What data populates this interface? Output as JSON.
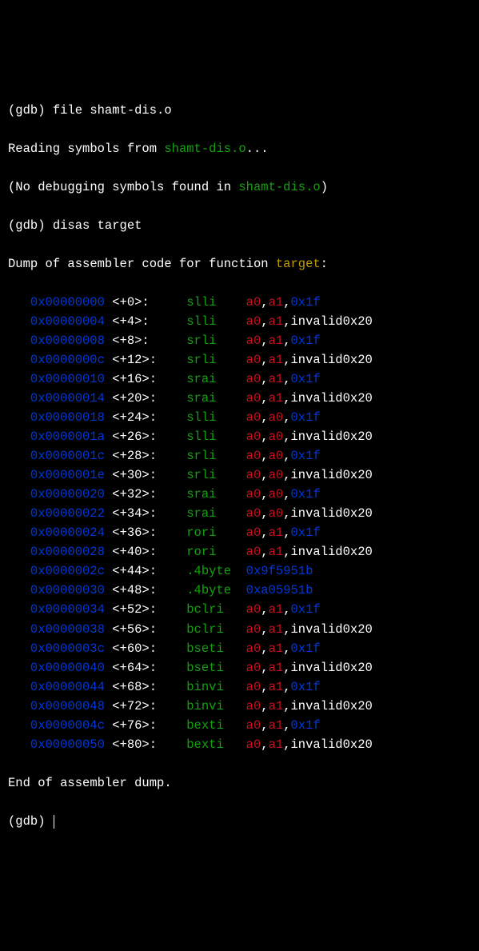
{
  "prompt": "(gdb) ",
  "cmd_file": "file shamt-dis.o",
  "reading_prefix": "Reading symbols from ",
  "filename": "shamt-dis.o",
  "reading_suffix": "...",
  "nodebug_prefix": "(No debugging symbols found in ",
  "nodebug_suffix": ")",
  "cmd_disas": "disas target",
  "dump_prefix": "Dump of assembler code for function ",
  "func": "target",
  "dump_suffix": ":",
  "end_dump": "End of assembler dump.",
  "rows": [
    {
      "addr": "0x00000000",
      "off": "<+0>:",
      "mn": "slli",
      "a0": "a0",
      "a1": "a1",
      "imm": "0x1f",
      "ic": "blue"
    },
    {
      "addr": "0x00000004",
      "off": "<+4>:",
      "mn": "slli",
      "a0": "a0",
      "a1": "a1",
      "imm": "invalid0x20",
      "ic": "white"
    },
    {
      "addr": "0x00000008",
      "off": "<+8>:",
      "mn": "srli",
      "a0": "a0",
      "a1": "a1",
      "imm": "0x1f",
      "ic": "blue"
    },
    {
      "addr": "0x0000000c",
      "off": "<+12>:",
      "mn": "srli",
      "a0": "a0",
      "a1": "a1",
      "imm": "invalid0x20",
      "ic": "white"
    },
    {
      "addr": "0x00000010",
      "off": "<+16>:",
      "mn": "srai",
      "a0": "a0",
      "a1": "a1",
      "imm": "0x1f",
      "ic": "blue"
    },
    {
      "addr": "0x00000014",
      "off": "<+20>:",
      "mn": "srai",
      "a0": "a0",
      "a1": "a1",
      "imm": "invalid0x20",
      "ic": "white"
    },
    {
      "addr": "0x00000018",
      "off": "<+24>:",
      "mn": "slli",
      "a0": "a0",
      "a1": "a0",
      "imm": "0x1f",
      "ic": "blue"
    },
    {
      "addr": "0x0000001a",
      "off": "<+26>:",
      "mn": "slli",
      "a0": "a0",
      "a1": "a0",
      "imm": "invalid0x20",
      "ic": "white"
    },
    {
      "addr": "0x0000001c",
      "off": "<+28>:",
      "mn": "srli",
      "a0": "a0",
      "a1": "a0",
      "imm": "0x1f",
      "ic": "blue"
    },
    {
      "addr": "0x0000001e",
      "off": "<+30>:",
      "mn": "srli",
      "a0": "a0",
      "a1": "a0",
      "imm": "invalid0x20",
      "ic": "white"
    },
    {
      "addr": "0x00000020",
      "off": "<+32>:",
      "mn": "srai",
      "a0": "a0",
      "a1": "a0",
      "imm": "0x1f",
      "ic": "blue"
    },
    {
      "addr": "0x00000022",
      "off": "<+34>:",
      "mn": "srai",
      "a0": "a0",
      "a1": "a0",
      "imm": "invalid0x20",
      "ic": "white"
    },
    {
      "addr": "0x00000024",
      "off": "<+36>:",
      "mn": "rori",
      "a0": "a0",
      "a1": "a1",
      "imm": "0x1f",
      "ic": "blue"
    },
    {
      "addr": "0x00000028",
      "off": "<+40>:",
      "mn": "rori",
      "a0": "a0",
      "a1": "a1",
      "imm": "invalid0x20",
      "ic": "white"
    },
    {
      "addr": "0x0000002c",
      "off": "<+44>:",
      "mn": ".4byte",
      "raw": "0x9f5951b"
    },
    {
      "addr": "0x00000030",
      "off": "<+48>:",
      "mn": ".4byte",
      "raw": "0xa05951b"
    },
    {
      "addr": "0x00000034",
      "off": "<+52>:",
      "mn": "bclri",
      "a0": "a0",
      "a1": "a1",
      "imm": "0x1f",
      "ic": "blue"
    },
    {
      "addr": "0x00000038",
      "off": "<+56>:",
      "mn": "bclri",
      "a0": "a0",
      "a1": "a1",
      "imm": "invalid0x20",
      "ic": "white"
    },
    {
      "addr": "0x0000003c",
      "off": "<+60>:",
      "mn": "bseti",
      "a0": "a0",
      "a1": "a1",
      "imm": "0x1f",
      "ic": "blue"
    },
    {
      "addr": "0x00000040",
      "off": "<+64>:",
      "mn": "bseti",
      "a0": "a0",
      "a1": "a1",
      "imm": "invalid0x20",
      "ic": "white"
    },
    {
      "addr": "0x00000044",
      "off": "<+68>:",
      "mn": "binvi",
      "a0": "a0",
      "a1": "a1",
      "imm": "0x1f",
      "ic": "blue"
    },
    {
      "addr": "0x00000048",
      "off": "<+72>:",
      "mn": "binvi",
      "a0": "a0",
      "a1": "a1",
      "imm": "invalid0x20",
      "ic": "white"
    },
    {
      "addr": "0x0000004c",
      "off": "<+76>:",
      "mn": "bexti",
      "a0": "a0",
      "a1": "a1",
      "imm": "0x1f",
      "ic": "blue"
    },
    {
      "addr": "0x00000050",
      "off": "<+80>:",
      "mn": "bexti",
      "a0": "a0",
      "a1": "a1",
      "imm": "invalid0x20",
      "ic": "white"
    }
  ]
}
